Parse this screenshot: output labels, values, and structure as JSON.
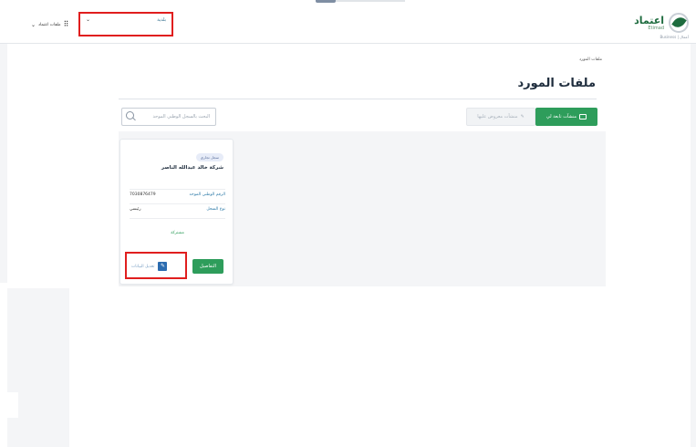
{
  "header": {
    "logo": {
      "ar_text": "اعتماد",
      "en_text": "Etimad",
      "sub_text": "Business | أعمال"
    },
    "entity_select": {
      "value": "بلدية",
      "chevron_icon": "chevron-down-icon"
    },
    "app_menu": {
      "label": "ملفات اعتماد",
      "icon": "grid-icon"
    }
  },
  "breadcrumb": "ملفات المورد",
  "page_title": "ملفات المورد",
  "toolbar": {
    "search_placeholder": "البحث بالسجل الوطني الموحد",
    "primary_button": "منشآت تابعة لي",
    "disabled_button": "منشآت معروض عليها"
  },
  "card": {
    "badge": "سجل تجاري",
    "name": "شركة خالد عبدالله الناصر",
    "rows": [
      {
        "label": "الرقم الوطني الموحد",
        "value": "7030876479"
      },
      {
        "label": "نوع السجل",
        "value": "رئيسي"
      }
    ],
    "more_link": "مشتركة",
    "details_button": "التفاصيل",
    "edit_link": "تعديل البيانات",
    "edit_icon": "pencil-icon"
  },
  "colors": {
    "primary": "#2e9d5b",
    "highlight": "#e01e1e",
    "link": "#2c7aa8"
  }
}
